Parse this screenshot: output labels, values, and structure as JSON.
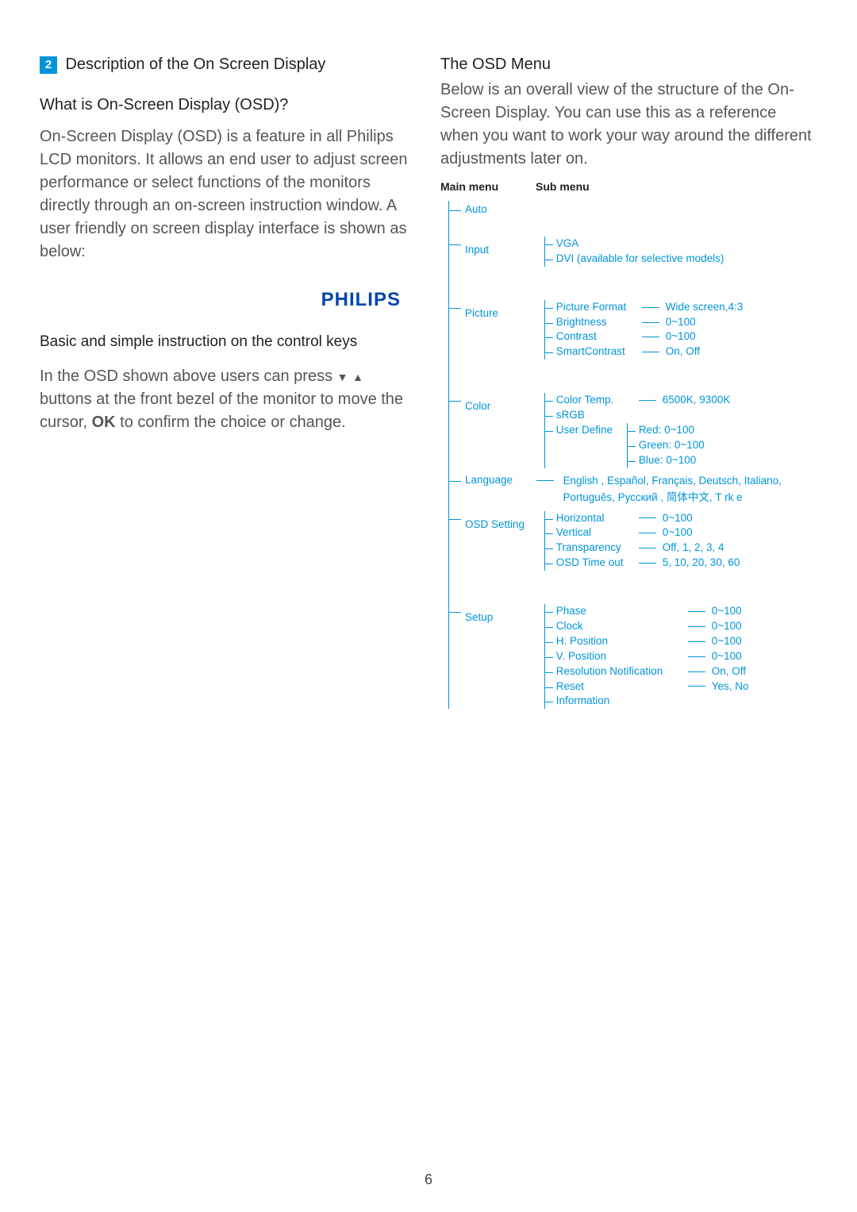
{
  "section": {
    "number": "2",
    "title": "Description of the On Screen Display"
  },
  "left": {
    "q_heading": "What is On-Screen Display (OSD)?",
    "q_body": "On-Screen Display (OSD) is a feature in all Philips LCD monitors. It allows an end user to adjust screen performance or select functions of the monitors directly through an on-screen instruction window. A user friendly on screen display interface is shown as below:",
    "logo": "PHILIPS",
    "control_heading": "Basic and simple instruction on the control keys",
    "control_body_1": "In the OSD shown above users can press ",
    "control_body_2": " buttons at the front bezel of the monitor to move the cursor, ",
    "ok_label": "OK",
    "control_body_3": " to confirm the choice or change."
  },
  "right": {
    "heading": "The OSD Menu",
    "body": "Below is an overall view of the structure of the On-Screen Display. You can use this as a reference when you want to work your way around the different adjustments later on.",
    "header_main": "Main menu",
    "header_sub": "Sub menu"
  },
  "menu": {
    "auto": "Auto",
    "input": {
      "label": "Input",
      "vga": "VGA",
      "dvi": "DVI (available for selective models)"
    },
    "picture": {
      "label": "Picture",
      "format": "Picture Format",
      "format_val": "Wide screen,4:3",
      "brightness": "Brightness",
      "brightness_val": "0~100",
      "contrast": "Contrast",
      "contrast_val": "0~100",
      "smart": "SmartContrast",
      "smart_val": "On, Off"
    },
    "color": {
      "label": "Color",
      "temp": "Color Temp.",
      "temp_val": "6500K, 9300K",
      "srgb": "sRGB",
      "user": "User Define",
      "red": "Red: 0~100",
      "green": "Green: 0~100",
      "blue": "Blue: 0~100"
    },
    "language": {
      "label": "Language",
      "line1": "English , Español, Français, Deutsch, Italiano,",
      "line2": "Português, Русский , 简体中文, T rk e"
    },
    "osd": {
      "label": "OSD Setting",
      "horizontal": "Horizontal",
      "horizontal_val": "0~100",
      "vertical": "Vertical",
      "vertical_val": "0~100",
      "transparency": "Transparency",
      "transparency_val": "Off, 1, 2, 3, 4",
      "timeout": "OSD Time out",
      "timeout_val": "5, 10, 20, 30, 60"
    },
    "setup": {
      "label": "Setup",
      "phase": "Phase",
      "phase_val": "0~100",
      "clock": "Clock",
      "clock_val": "0~100",
      "hpos": "H. Position",
      "hpos_val": "0~100",
      "vpos": "V. Position",
      "vpos_val": "0~100",
      "res": "Resolution Notification",
      "res_val": "On, Off",
      "reset": "Reset",
      "reset_val": "Yes, No",
      "info": "Information"
    }
  },
  "page_number": "6"
}
